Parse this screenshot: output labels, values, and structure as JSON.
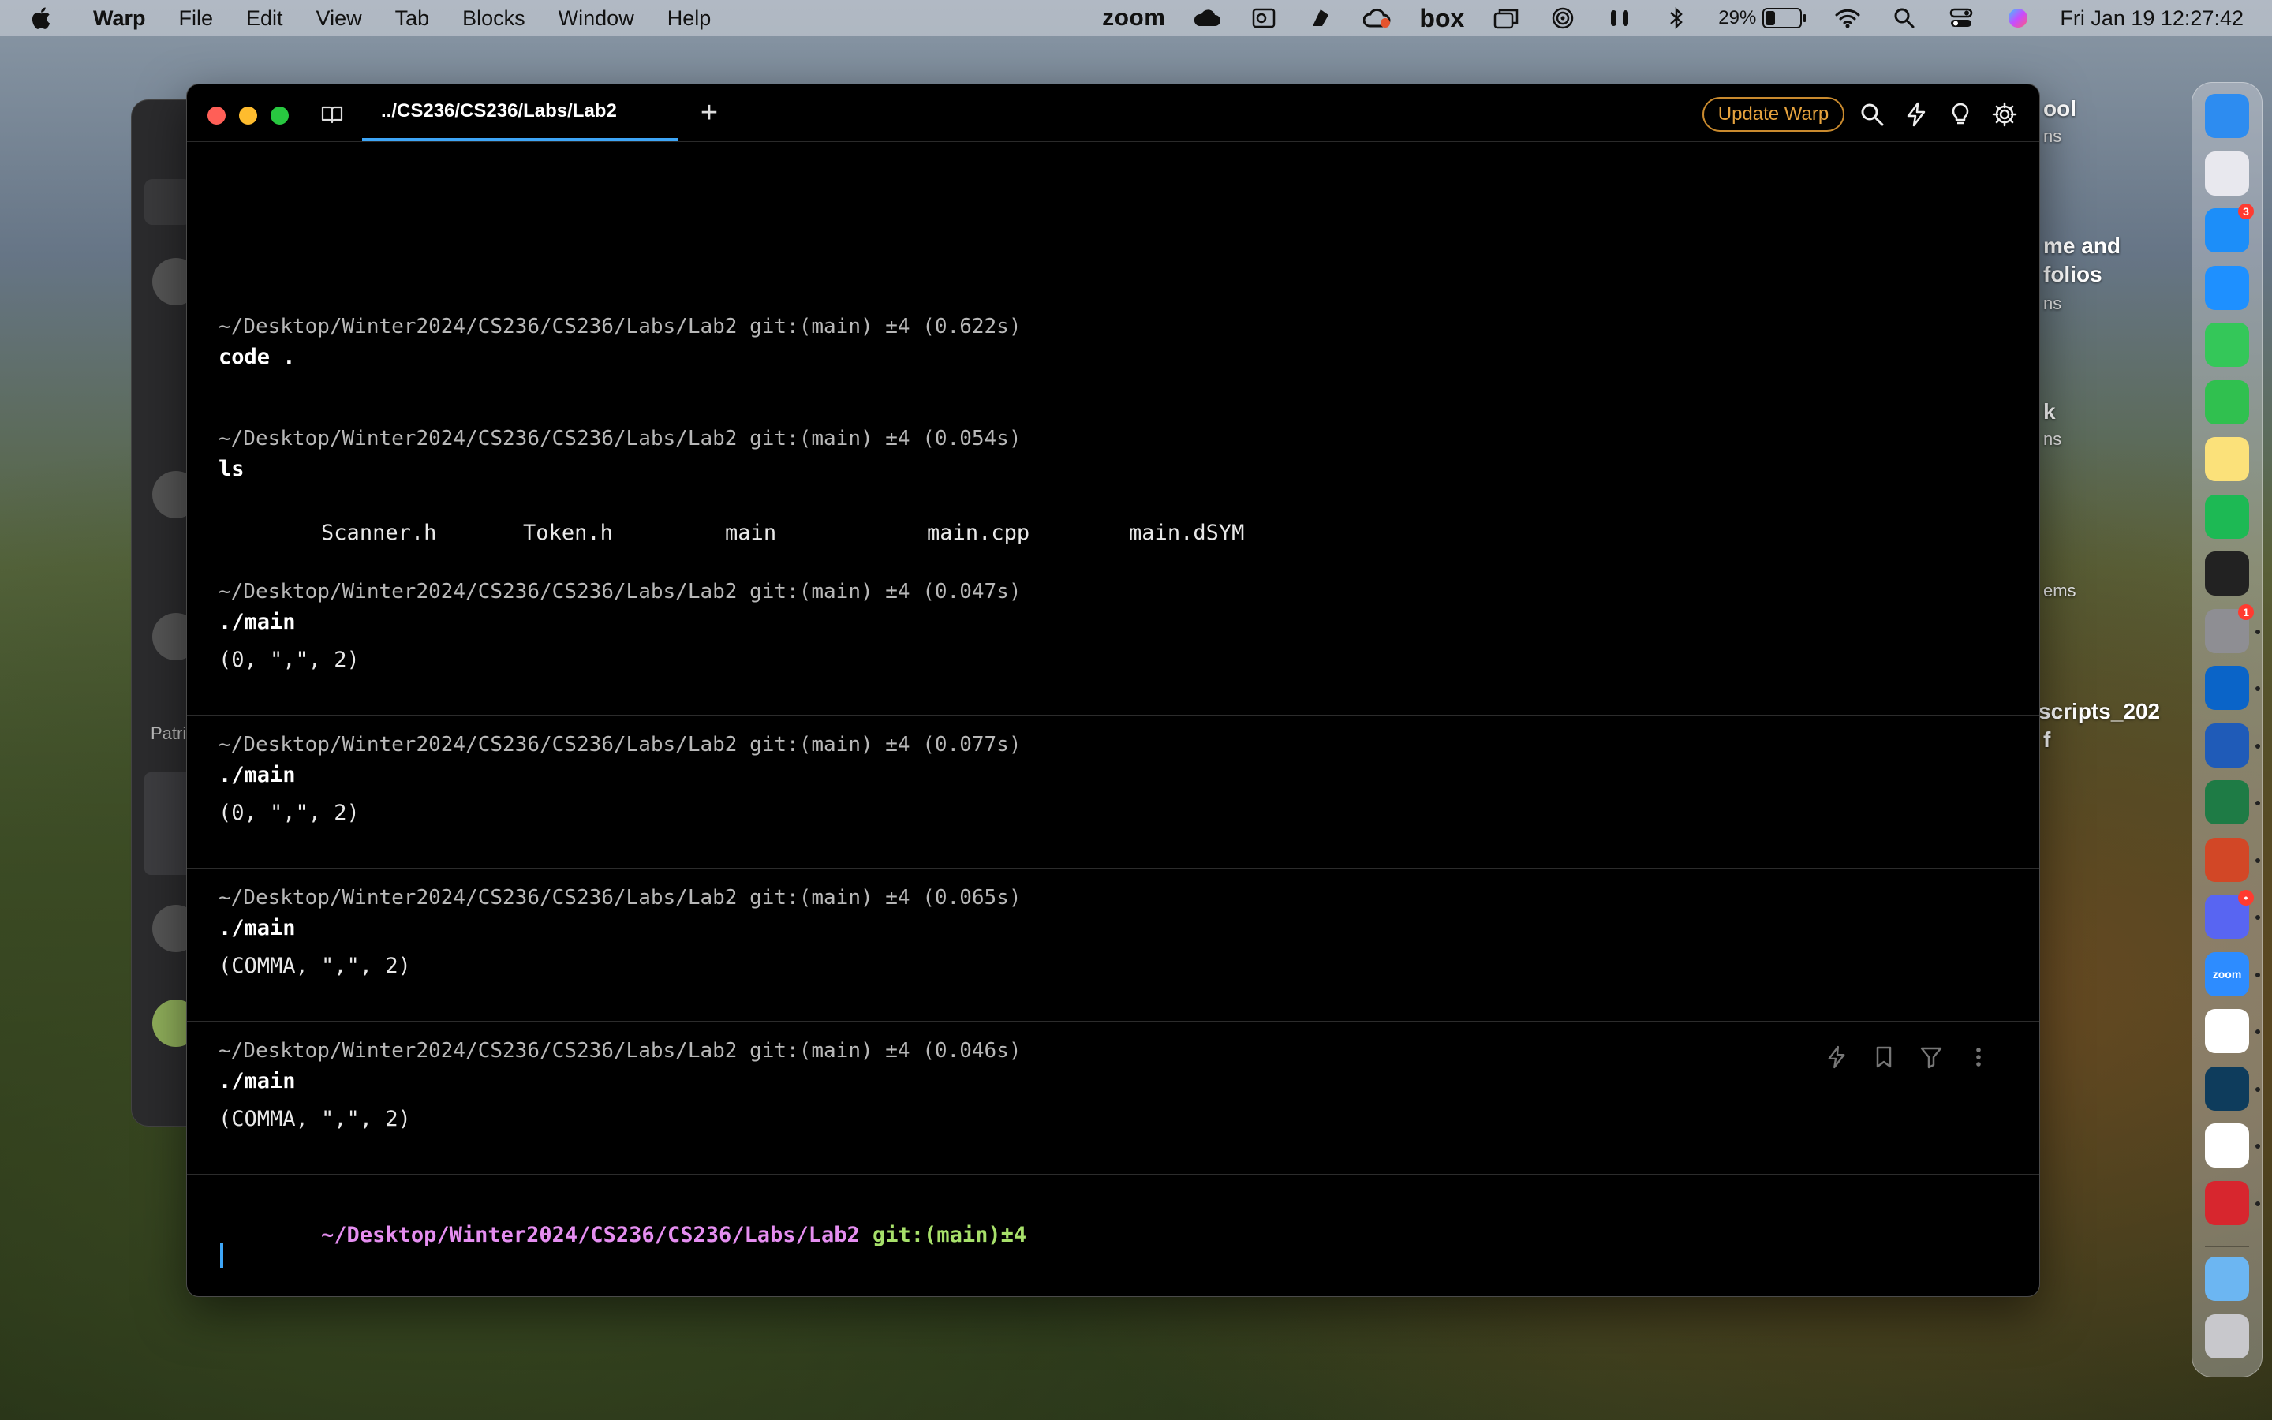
{
  "menubar": {
    "app_name": "Warp",
    "menus": [
      "File",
      "Edit",
      "View",
      "Tab",
      "Blocks",
      "Window",
      "Help"
    ],
    "zoom_label": "zoom",
    "box_label": "box",
    "battery_percent": "29%",
    "battery_level": 0.29,
    "datetime": "Fri Jan 19  12:27:42"
  },
  "desktop": {
    "labels": [
      "ool",
      "ns",
      "me and",
      "folios",
      "ns",
      "k",
      "ns",
      "ems",
      "scripts_202",
      "f"
    ],
    "bg_window_label": "Patri"
  },
  "warp": {
    "tab_title": "../CS236/CS236/Labs/Lab2",
    "update_button": "Update Warp",
    "blocks": [
      {
        "prompt": "~/Desktop/Winter2024/CS236/CS236/Labs/Lab2 git:(main) ±4 (0.622s)",
        "command": "code .",
        "output": ""
      },
      {
        "prompt": "~/Desktop/Winter2024/CS236/CS236/Labs/Lab2 git:(main) ±4 (0.054s)",
        "command": "ls",
        "output_files": [
          "Scanner.h",
          "Token.h",
          "main",
          "main.cpp",
          "main.dSYM"
        ]
      },
      {
        "prompt": "~/Desktop/Winter2024/CS236/CS236/Labs/Lab2 git:(main) ±4 (0.047s)",
        "command": "./main",
        "output": "(0, \",\", 2)"
      },
      {
        "prompt": "~/Desktop/Winter2024/CS236/CS236/Labs/Lab2 git:(main) ±4 (0.077s)",
        "command": "./main",
        "output": "(0, \",\", 2)"
      },
      {
        "prompt": "~/Desktop/Winter2024/CS236/CS236/Labs/Lab2 git:(main) ±4 (0.065s)",
        "command": "./main",
        "output": "(COMMA, \",\", 2)"
      },
      {
        "prompt": "~/Desktop/Winter2024/CS236/CS236/Labs/Lab2 git:(main) ±4 (0.046s)",
        "command": "./main",
        "output": "(COMMA, \",\", 2)"
      }
    ],
    "active_prompt": {
      "path": "~/Desktop/Winter2024/CS236/CS236/Labs/Lab2",
      "git": " git:(main)±4"
    }
  },
  "dock": {
    "apps": [
      {
        "name": "Finder",
        "color": "#2d8cf0",
        "badge": ""
      },
      {
        "name": "Launchpad",
        "color": "#e8e8ee",
        "badge": ""
      },
      {
        "name": "App Store",
        "color": "#1c8ef9",
        "badge": "3"
      },
      {
        "name": "Safari",
        "color": "#1e90ff",
        "badge": ""
      },
      {
        "name": "Messages",
        "color": "#34c759",
        "badge": ""
      },
      {
        "name": "FaceTime",
        "color": "#30c04f",
        "badge": ""
      },
      {
        "name": "Notes",
        "color": "#fbe17a",
        "badge": ""
      },
      {
        "name": "Spotify",
        "color": "#1db954",
        "badge": ""
      },
      {
        "name": "Terminal",
        "color": "#222222",
        "badge": ""
      },
      {
        "name": "System Settings",
        "color": "#8e8e93",
        "badge": "1"
      },
      {
        "name": "Outlook",
        "color": "#0a64c8",
        "badge": ""
      },
      {
        "name": "Word",
        "color": "#1f5bb8",
        "badge": ""
      },
      {
        "name": "Excel",
        "color": "#1e7b45",
        "badge": ""
      },
      {
        "name": "PowerPoint",
        "color": "#d24726",
        "badge": ""
      },
      {
        "name": "Discord",
        "color": "#5865f2",
        "badge": "•"
      },
      {
        "name": "Zoom",
        "color": "#2d8cff",
        "badge": ""
      },
      {
        "name": "Slack",
        "color": "#ffffff",
        "badge": ""
      },
      {
        "name": "Warp",
        "color": "#0e3c5c",
        "badge": ""
      },
      {
        "name": "VS Code",
        "color": "#ffffff",
        "badge": ""
      },
      {
        "name": "Acrobat",
        "color": "#d7262e",
        "badge": ""
      },
      {
        "name": "Downloads",
        "color": "#6cb6f2",
        "badge": ""
      },
      {
        "name": "Trash",
        "color": "#c8c8cc",
        "badge": ""
      }
    ],
    "zoom_icon_text": "zoom"
  }
}
